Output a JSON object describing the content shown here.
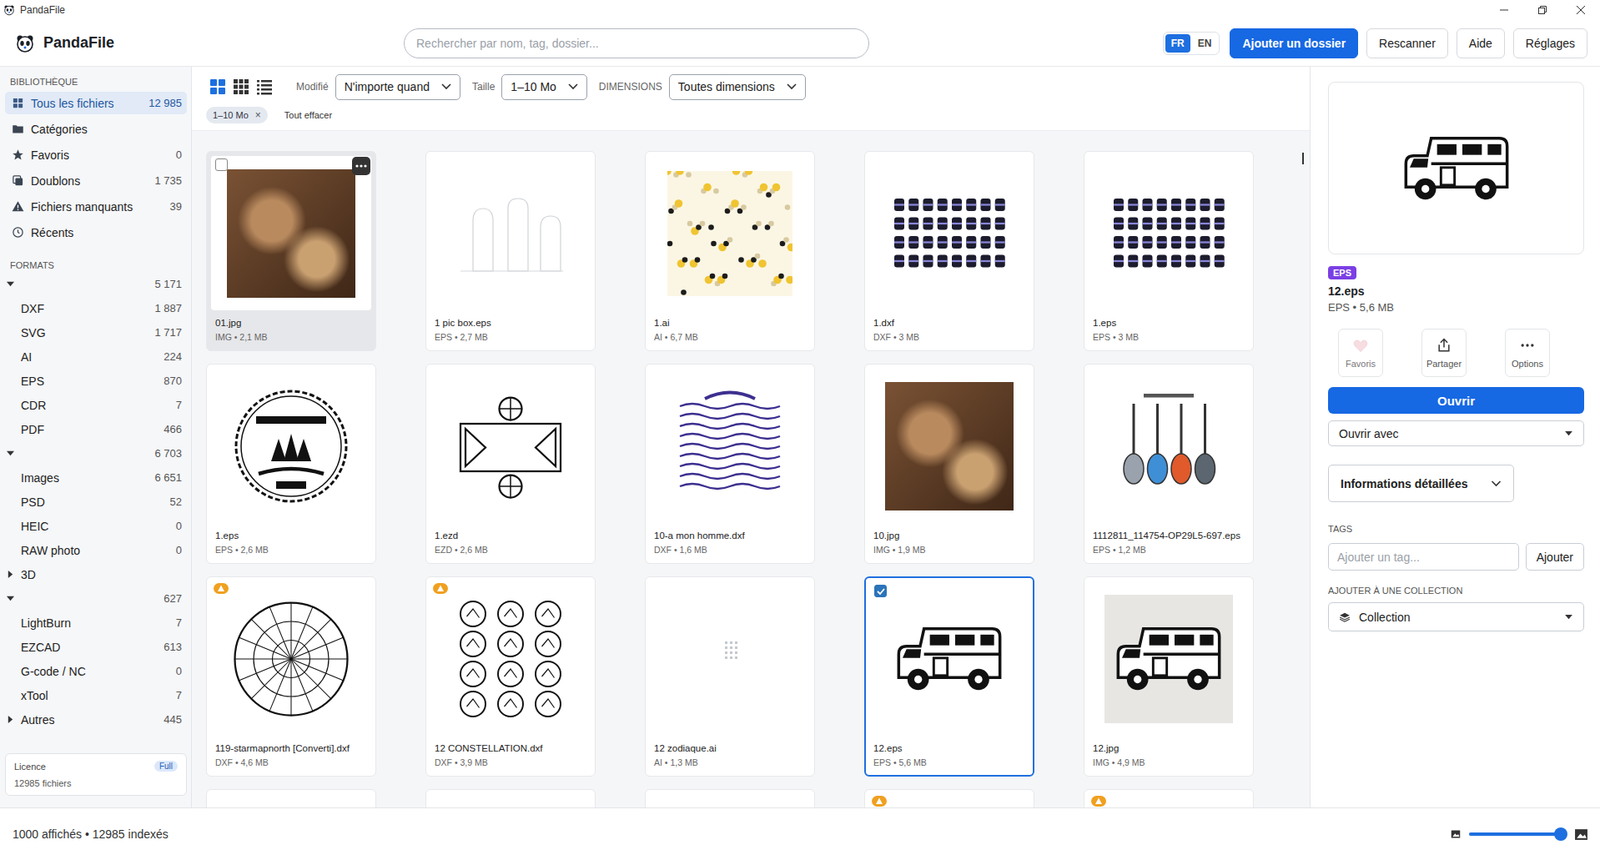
{
  "window": {
    "title": "PandaFile"
  },
  "header": {
    "app_name": "PandaFile",
    "search": {
      "placeholder": "Rechercher par nom, tag, dossier..."
    },
    "languages": [
      {
        "label": "FR",
        "selected": true
      },
      {
        "label": "EN",
        "selected": false
      }
    ],
    "buttons": [
      {
        "label": "Ajouter un dossier",
        "kind": "primary"
      },
      {
        "label": "Rescanner",
        "kind": "plain"
      },
      {
        "label": "Aide",
        "kind": "plain"
      },
      {
        "label": "Réglages",
        "kind": "plain"
      }
    ]
  },
  "sidebar": {
    "library": {
      "title": "BIBLIOTHÈQUE",
      "items": [
        {
          "label": "Tous les fichiers",
          "count": "12 985",
          "selected": true
        },
        {
          "label": "Catégories",
          "count": "",
          "selected": false
        },
        {
          "label": "Favoris",
          "count": "0",
          "selected": false
        },
        {
          "label": "Doublons",
          "count": "1 735",
          "selected": false
        },
        {
          "label": "Fichiers manquants",
          "count": "39",
          "selected": false
        },
        {
          "label": "Récents",
          "count": "",
          "selected": false
        }
      ]
    },
    "formats": {
      "title": "FORMATS",
      "groups": [
        {
          "label": "",
          "count": "5 171",
          "expanded": true,
          "items": [
            {
              "label": "DXF",
              "count": "1 887"
            },
            {
              "label": "SVG",
              "count": "1 717"
            },
            {
              "label": "AI",
              "count": "224"
            },
            {
              "label": "EPS",
              "count": "870"
            },
            {
              "label": "CDR",
              "count": "7"
            },
            {
              "label": "PDF",
              "count": "466"
            }
          ]
        },
        {
          "label": "",
          "count": "6 703",
          "expanded": true,
          "items": [
            {
              "label": "Images",
              "count": "6 651"
            },
            {
              "label": "PSD",
              "count": "52"
            },
            {
              "label": "HEIC",
              "count": "0"
            },
            {
              "label": "RAW photo",
              "count": "0"
            }
          ]
        },
        {
          "label": "3D",
          "count": "",
          "expanded": false,
          "items": []
        },
        {
          "label": "",
          "count": "627",
          "expanded": true,
          "items": [
            {
              "label": "LightBurn",
              "count": "7"
            },
            {
              "label": "EZCAD",
              "count": "613"
            },
            {
              "label": "G-code / NC",
              "count": "0"
            },
            {
              "label": "xTool",
              "count": "7"
            }
          ]
        },
        {
          "label": "Autres",
          "count": "445",
          "expanded": false,
          "items": []
        }
      ]
    },
    "licence": {
      "label": "Licence",
      "badge": "Full",
      "files": "12985 fichiers"
    }
  },
  "toolbar": {
    "views": [
      {
        "selected": true
      },
      {
        "selected": false
      },
      {
        "selected": false
      }
    ],
    "filters": [
      {
        "label": "Modifié",
        "value": "N'importe quand"
      },
      {
        "label": "Taille",
        "value": "1–10 Mo"
      },
      {
        "label": "DIMENSIONS",
        "value": "Toutes dimensions"
      }
    ],
    "chips": [
      {
        "label": "1–10 Mo",
        "remove": "×"
      }
    ],
    "clear_all": "Tout effacer"
  },
  "grid": {
    "cards": [
      {
        "name": "01.jpg",
        "meta": "IMG • 2,1 MB",
        "kind": "photo",
        "selected": false,
        "hovered": true,
        "warning": false
      },
      {
        "name": "1 pic box.eps",
        "meta": "EPS • 2,7 MB",
        "kind": "faint",
        "selected": false,
        "hovered": false,
        "warning": false
      },
      {
        "name": "1.ai",
        "meta": "AI • 6,7 MB",
        "kind": "pattern",
        "selected": false,
        "hovered": false,
        "warning": false
      },
      {
        "name": "1.dxf",
        "meta": "DXF • 3 MB",
        "kind": "letters",
        "selected": false,
        "hovered": false,
        "warning": false
      },
      {
        "name": "1.eps",
        "meta": "EPS • 3 MB",
        "kind": "letters",
        "selected": false,
        "hovered": false,
        "warning": false
      },
      {
        "name": "1.eps",
        "meta": "EPS • 2,6 MB",
        "kind": "badge",
        "selected": false,
        "hovered": false,
        "warning": false
      },
      {
        "name": "1.ezd",
        "meta": "EZD • 2,6 MB",
        "kind": "frame",
        "selected": false,
        "hovered": false,
        "warning": false
      },
      {
        "name": "10-a mon homme.dxf",
        "meta": "DXF • 1,6 MB",
        "kind": "script",
        "selected": false,
        "hovered": false,
        "warning": false
      },
      {
        "name": "10.jpg",
        "meta": "IMG • 1,9 MB",
        "kind": "photo",
        "selected": false,
        "hovered": false,
        "warning": false
      },
      {
        "name": "1112811_114754-OP29L5-697.eps",
        "meta": "EPS • 1,2 MB",
        "kind": "guitars",
        "selected": false,
        "hovered": false,
        "warning": false
      },
      {
        "name": "119-starmapnorth [Converti].dxf",
        "meta": "DXF • 4,6 MB",
        "kind": "starmap",
        "selected": false,
        "hovered": false,
        "warning": true
      },
      {
        "name": "12 CONSTELLATION.dxf",
        "meta": "DXF • 3,9 MB",
        "kind": "circles",
        "selected": false,
        "hovered": false,
        "warning": true
      },
      {
        "name": "12 zodiaque.ai",
        "meta": "AI • 1,3 MB",
        "kind": "dots",
        "selected": false,
        "hovered": false,
        "warning": false
      },
      {
        "name": "12.eps",
        "meta": "EPS • 5,6 MB",
        "kind": "van",
        "selected": true,
        "hovered": false,
        "warning": false
      },
      {
        "name": "12.jpg",
        "meta": "IMG • 4,9 MB",
        "kind": "tinted",
        "selected": false,
        "hovered": false,
        "warning": false
      },
      {
        "name": "",
        "meta": "",
        "kind": "blank",
        "selected": false,
        "hovered": false,
        "warning": false
      },
      {
        "name": "",
        "meta": "",
        "kind": "blank",
        "selected": false,
        "hovered": false,
        "warning": false
      },
      {
        "name": "",
        "meta": "",
        "kind": "blank",
        "selected": false,
        "hovered": false,
        "warning": false
      },
      {
        "name": "",
        "meta": "",
        "kind": "blank",
        "selected": false,
        "hovered": false,
        "warning": true
      },
      {
        "name": "",
        "meta": "",
        "kind": "blank",
        "selected": false,
        "hovered": false,
        "warning": true
      }
    ]
  },
  "details": {
    "preview_kind": "van",
    "badge": "EPS",
    "name": "12.eps",
    "meta": "EPS • 5,6 MB",
    "actions": [
      {
        "label": "Favoris",
        "disabled": true
      },
      {
        "label": "Partager",
        "disabled": false
      },
      {
        "label": "Options",
        "disabled": false
      }
    ],
    "open": "Ouvrir",
    "open_with": "Ouvrir avec",
    "info": {
      "label": "Informations détaillées",
      "expanded": false
    },
    "tags": {
      "title": "TAGS",
      "placeholder": "Ajouter un tag...",
      "button": "Ajouter"
    },
    "collection": {
      "title": "AJOUTER À UNE COLLECTION",
      "value": "Collection"
    }
  },
  "status_bar": {
    "text": "1000 affichés • 12985 indexés",
    "zoom": {
      "level": 1
    }
  }
}
